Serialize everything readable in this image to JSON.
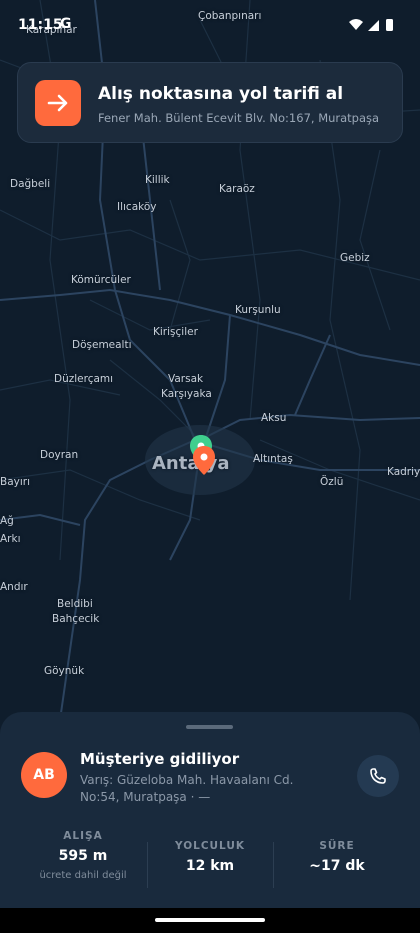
{
  "status_bar": {
    "time": "11:15",
    "provider_letter": "G"
  },
  "banner": {
    "title": "Alış noktasına yol tarifi al",
    "address": "Fener Mah. Bülent Ecevit Blv. No:167, Muratpaşa",
    "icon": "arrow-right-icon",
    "accent": "#ff6a3d"
  },
  "map": {
    "places": [
      "Karapınar",
      "Çobanpınarı",
      "Dağbeli",
      "Killik",
      "Karaöz",
      "Ilıcaköy",
      "Gebiz",
      "Kömürcüler",
      "Kurşunlu",
      "Kirişçiler",
      "Döşemealtı",
      "Düzlerçamı",
      "Varsak",
      "Karşıyaka",
      "Aksu",
      "Doyran",
      "Antalya",
      "Altıntaş",
      "Kadriy",
      "Özlü",
      "Bayırı",
      "Ağ",
      "Arkı",
      "Andır",
      "Beldibi",
      "Bahçecik",
      "Göynük"
    ]
  },
  "sheet": {
    "avatar_initials": "AB",
    "title": "Müşteriye gidiliyor",
    "destination": "Varış: Güzeloba Mah. Havaalanı Cd. No:54, Muratpaşa · —",
    "call_icon": "phone-icon",
    "stats": [
      {
        "label": "ALIŞA",
        "value": "595 m",
        "sub": "ücrete dahil değil"
      },
      {
        "label": "YOLCULUK",
        "value": "12 km"
      },
      {
        "label": "SÜRE",
        "value": "~17 dk"
      }
    ]
  }
}
